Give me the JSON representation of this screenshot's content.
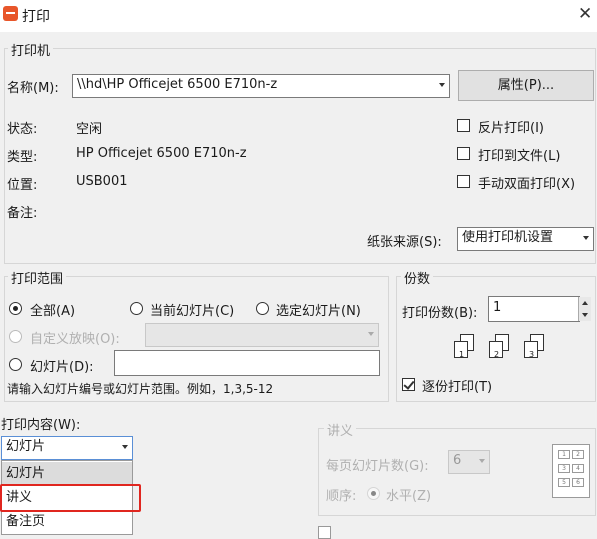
{
  "window": {
    "title": "打印",
    "close_glyph": "✕"
  },
  "printer": {
    "group_label": "打印机",
    "name_label": "名称(M):",
    "name_value": "\\\\hd\\HP Officejet 6500 E710n-z",
    "properties_button": "属性(P)...",
    "status_label": "状态:",
    "status_value": "空闲",
    "type_label": "类型:",
    "type_value": "HP Officejet 6500 E710n-z",
    "location_label": "位置:",
    "location_value": "USB001",
    "comment_label": "备注:",
    "reverse_print": "反片打印(I)",
    "print_to_file": "打印到文件(L)",
    "manual_duplex": "手动双面打印(X)",
    "paper_source_label": "纸张来源(S):",
    "paper_source_value": "使用打印机设置"
  },
  "range": {
    "group_label": "打印范围",
    "all": "全部(A)",
    "current_slide": "当前幻灯片(C)",
    "selected_slides": "选定幻灯片(N)",
    "custom_show": "自定义放映(O):",
    "slides": "幻灯片(D):",
    "slides_value": "",
    "hint": "请输入幻灯片编号或幻灯片范围。例如，1,3,5-12"
  },
  "copies": {
    "group_label": "份数",
    "count_label": "打印份数(B):",
    "count_value": "1",
    "collate": "逐份打印(T)",
    "page_numbers": [
      "1",
      "2",
      "3"
    ]
  },
  "content": {
    "label": "打印内容(W):",
    "selected": "幻灯片",
    "options": [
      "幻灯片",
      "讲义",
      "备注页"
    ],
    "highlighted_index": 0,
    "boxed_index": 1
  },
  "handouts": {
    "group_label": "讲义",
    "per_page_label": "每页幻灯片数(G):",
    "per_page_value": "6",
    "order_label": "顺序:",
    "horizontal": "水平(Z)",
    "grid_numbers": [
      "1",
      "2",
      "3",
      "4",
      "5",
      "6"
    ]
  },
  "colors": {
    "highlight_box": "#e0261f",
    "app_icon": "#e8562a"
  }
}
